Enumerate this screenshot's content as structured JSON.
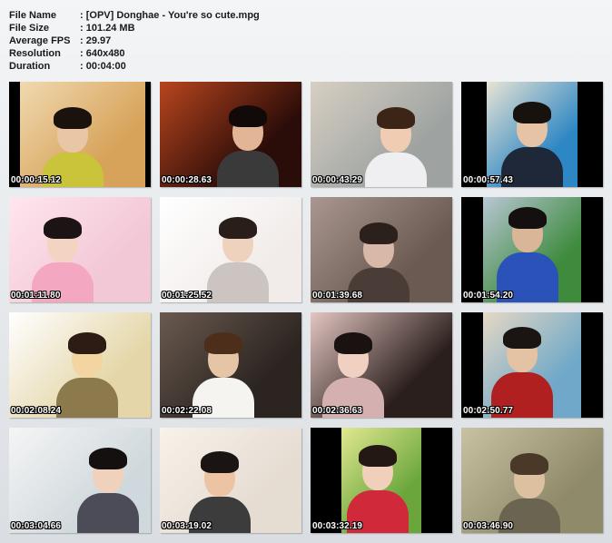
{
  "file_info": [
    {
      "label": "File Name",
      "value": ": [OPV] Donghae - You're so cute.mpg"
    },
    {
      "label": "File Size",
      "value": ": 101.24 MB"
    },
    {
      "label": "Average FPS",
      "value": ": 29.97"
    },
    {
      "label": "Resolution",
      "value": ": 640x480"
    },
    {
      "label": "Duration",
      "value": ": 00:04:00"
    }
  ],
  "thumbnails": [
    {
      "time": "00:00:15.12",
      "bg": "#d7a35a",
      "bg2": "#f0d9b0",
      "hair": "#1b120e",
      "skin": "#e9c7a6",
      "body": "#c9c43a"
    },
    {
      "time": "00:00:28.63",
      "bg": "#2a0c08",
      "bg2": "#b8451e",
      "hair": "#120a08",
      "skin": "#e2b596",
      "body": "#3a3a3a"
    },
    {
      "time": "00:00:43.29",
      "bg": "#9ea3a1",
      "bg2": "#d7cfc3",
      "hair": "#3c2516",
      "skin": "#f0cdb2",
      "body": "#efeef0"
    },
    {
      "time": "00:00:57.43",
      "bg": "#2d87c4",
      "bg2": "#e8e4d4",
      "hair": "#18120e",
      "skin": "#e6c3a4",
      "body": "#1e2838"
    },
    {
      "time": "00:01:11.80",
      "bg": "#f2c7d6",
      "bg2": "#ffe6ee",
      "hair": "#1c1414",
      "skin": "#f3d4c2",
      "body": "#f4a7c0"
    },
    {
      "time": "00:01:25.52",
      "bg": "#f1ecea",
      "bg2": "#ffffff",
      "hair": "#2a1e1a",
      "skin": "#efd2bd",
      "body": "#cbc4c0"
    },
    {
      "time": "00:01:39.68",
      "bg": "#6a5a52",
      "bg2": "#aa9890",
      "hair": "#2c201c",
      "skin": "#d8b8a6",
      "body": "#4a3c36"
    },
    {
      "time": "00:01:54.20",
      "bg": "#3e8b3e",
      "bg2": "#b8c6d4",
      "hair": "#141010",
      "skin": "#d9b697",
      "body": "#2a52b8"
    },
    {
      "time": "00:02:08.24",
      "bg": "#e4d6a8",
      "bg2": "#ffffff",
      "hair": "#2c1c14",
      "skin": "#f2d5a0",
      "body": "#8c7a4c"
    },
    {
      "time": "00:02:22.08",
      "bg": "#2b2420",
      "bg2": "#6a5a50",
      "hair": "#4c2e1a",
      "skin": "#e6c4a6",
      "body": "#f6f4f0"
    },
    {
      "time": "00:02:36.63",
      "bg": "#2a1f1c",
      "bg2": "#e4c6c2",
      "hair": "#1a1210",
      "skin": "#f0d0c0",
      "body": "#d5b0b0"
    },
    {
      "time": "00:02:50.77",
      "bg": "#6fa8c8",
      "bg2": "#e6d8c4",
      "hair": "#1a1412",
      "skin": "#e4c2a4",
      "body": "#b02020"
    },
    {
      "time": "00:03:04.66",
      "bg": "#cfd8dc",
      "bg2": "#f5f5f5",
      "hair": "#141010",
      "skin": "#f0d2bc",
      "body": "#4c4c58"
    },
    {
      "time": "00:03:19.02",
      "bg": "#e5dcd2",
      "bg2": "#f8f2ea",
      "hair": "#1a1412",
      "skin": "#ecc4a4",
      "body": "#3c3c3c"
    },
    {
      "time": "00:03:32.19",
      "bg": "#6aa63c",
      "bg2": "#e2e890",
      "hair": "#241814",
      "skin": "#f0d0ba",
      "body": "#d02a3a"
    },
    {
      "time": "00:03:46.90",
      "bg": "#8f8a6a",
      "bg2": "#c8c2a2",
      "hair": "#4a3828",
      "skin": "#dcc0a0",
      "body": "#6a6450"
    }
  ]
}
